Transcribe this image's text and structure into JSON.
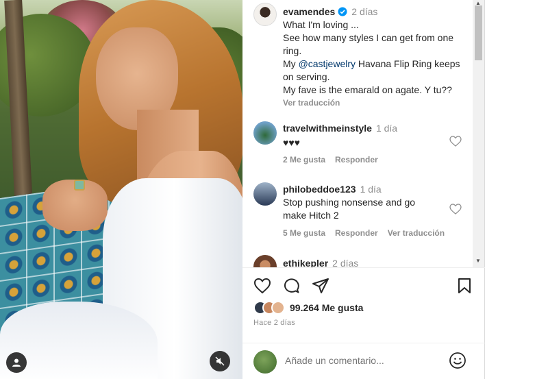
{
  "post": {
    "author": "evamendes",
    "time": "2 días",
    "caption_lines": [
      "What I'm loving ...",
      "See how many styles I can get from one ring.",
      "My ",
      "@castjewelry",
      " Havana Flip Ring keeps on serving.",
      "My fave is the emarald on agate. Y tu??"
    ],
    "translate": "Ver traducción"
  },
  "comments": [
    {
      "user": "travelwithmeinstyle",
      "time": "1 día",
      "text": "♥♥♥",
      "likes": "2 Me gusta",
      "reply": "Responder"
    },
    {
      "user": "philobeddoe123",
      "time": "1 día",
      "text": "Stop pushing nonsense and go make Hitch 2",
      "likes": "5 Me gusta",
      "reply": "Responder",
      "translate": "Ver traducción"
    },
    {
      "user": "ethikepler",
      "time": "2 días"
    }
  ],
  "actions": {
    "likes_count": "99.264 Me gusta",
    "ago": "Hace 2 días"
  },
  "add_comment": {
    "placeholder": "Añade un comentario..."
  },
  "icons": [
    "user-icon",
    "mute-icon",
    "verified-icon",
    "heart-icon",
    "comment-icon",
    "share-icon",
    "bookmark-icon",
    "emoji-icon"
  ],
  "colors": {
    "link": "#00376b",
    "muted": "#8e8e8e",
    "verified": "#0095f6"
  }
}
